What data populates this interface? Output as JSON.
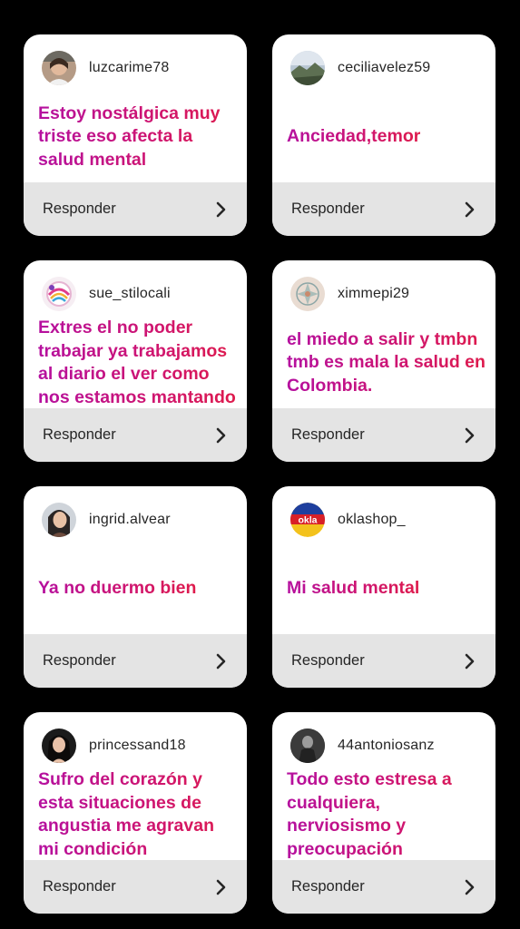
{
  "cards": [
    {
      "username": "luzcarime78",
      "message": "Estoy nostálgica muy triste eso afecta la salud mental",
      "reply_label": "Responder",
      "avatar_icon": "user-photo-avatar"
    },
    {
      "username": "ceciliavelez59",
      "message": "Anciedad,temor",
      "reply_label": "Responder",
      "avatar_icon": "landscape-photo-avatar"
    },
    {
      "username": "sue_stilocali",
      "message": "Extres el no poder trabajar ya trabajamos al diario el ver como nos estamos mantando",
      "reply_label": "Responder",
      "avatar_icon": "colorful-logo-avatar"
    },
    {
      "username": "ximmepi29",
      "message": "el miedo a salir y tmbn tmb es mala la salud en Colombia.",
      "reply_label": "Responder",
      "avatar_icon": "mandala-avatar"
    },
    {
      "username": "ingrid.alvear",
      "message": "Ya no duermo bien",
      "reply_label": "Responder",
      "avatar_icon": "user-photo-avatar"
    },
    {
      "username": "oklashop_",
      "message": "Mi salud mental",
      "reply_label": "Responder",
      "avatar_icon": "okla-logo-avatar",
      "avatar_text": "okla"
    },
    {
      "username": "princessand18",
      "message": "Sufro del corazón y esta situaciones de angustia me agravan mi condición",
      "reply_label": "Responder",
      "avatar_icon": "user-photo-avatar"
    },
    {
      "username": "44antoniosanz",
      "message": "Todo esto estresa a cualquiera, nerviosismo y preocupación",
      "reply_label": "Responder",
      "avatar_icon": "user-photo-avatar"
    }
  ],
  "colors": {
    "background": "#000000",
    "card": "#ffffff",
    "reply_bar": "#e4e4e4",
    "message_gradient_start": "#b5109f",
    "message_gradient_end": "#de1a4b"
  }
}
